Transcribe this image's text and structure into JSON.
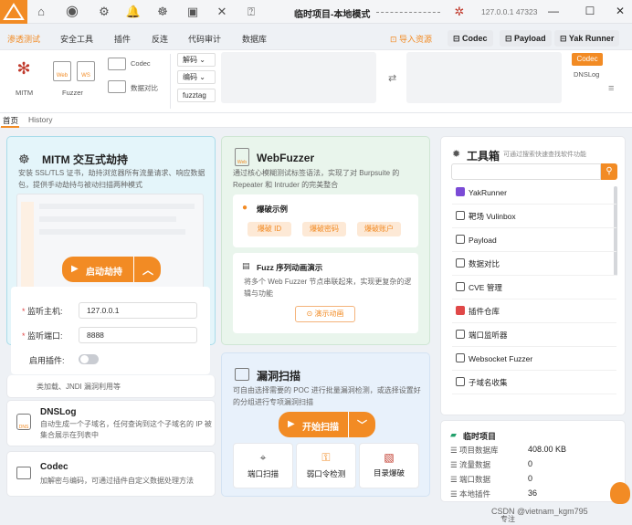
{
  "titlebar": {
    "title": "临时项目-本地模式",
    "ip": "127.0.0.1",
    "port": "47323"
  },
  "menu": {
    "items": [
      "渗透测试",
      "安全工具",
      "插件",
      "反连",
      "代码审计",
      "数据库"
    ],
    "import": "导入资源",
    "buttons": [
      "Codec",
      "Payload",
      "Yak Runner"
    ]
  },
  "toolbar": {
    "mitm": "MITM",
    "fuzzer": "Fuzzer",
    "web": "Web",
    "ws": "WS",
    "codec": "Codec",
    "compare": "数据对比",
    "decode": "解码",
    "encode": "编码",
    "fuzztag": "fuzztag",
    "codec_chip": "Codec",
    "dnslog": "DNSLog"
  },
  "tabs": {
    "home": "首页",
    "history": "History"
  },
  "mitm": {
    "title": "MITM 交互式劫持",
    "desc": "安装 SSL/TLS 证书，劫持浏览器所有流量请求、响应数据包，提供手动劫持与被动扫描两种模式",
    "start": "启动劫持",
    "host_label": "监听主机:",
    "host": "127.0.0.1",
    "port_label": "监听端口:",
    "port": "8888",
    "plugin_label": "启用插件:",
    "behind_text": "类加载、JNDI 漏洞利用等"
  },
  "webfuzzer": {
    "title": "WebFuzzer",
    "desc": "通过核心模糊测试标签语法，实现了对 Burpsuite 的 Repeater 和 Intruder 的完美整合",
    "blast_title": "爆破示例",
    "chips": [
      "爆破 ID",
      "爆破密码",
      "爆破账户"
    ],
    "seq_title": "Fuzz 序列动画演示",
    "seq_desc": "将多个 Web Fuzzer 节点串联起来，实现更复杂的逻辑与功能",
    "demo": "演示动画"
  },
  "scan": {
    "title": "漏洞扫描",
    "desc": "可自由选择需要的 POC 进行批量漏洞检测，或选择设置好的分组进行专项漏洞扫描",
    "start": "开始扫描",
    "tools": [
      "端口扫描",
      "弱口令检测",
      "目录爆破"
    ]
  },
  "dnslog": {
    "title": "DNSLog",
    "desc": "自动生成一个子域名，任何查询到这个子域名的 IP 被集合展示在列表中"
  },
  "codec": {
    "title": "Codec",
    "desc": "加解密与编码，可通过插件自定义数据处理方法"
  },
  "toolbox": {
    "title": "工具箱",
    "hint": "可通过搜索快速查找软件功能",
    "items": [
      "YakRunner",
      "靶场 Vulinbox",
      "Payload",
      "数据对比",
      "CVE 管理",
      "插件仓库",
      "端口监听器",
      "Websocket Fuzzer",
      "子域名收集"
    ]
  },
  "project": {
    "title": "临时项目",
    "stats": [
      {
        "label": "项目数据库",
        "value": "408.00 KB"
      },
      {
        "label": "流量数据",
        "value": "0"
      },
      {
        "label": "端口数据",
        "value": "0"
      },
      {
        "label": "本地插件",
        "value": "36"
      }
    ]
  },
  "status": {
    "watermark": "CSDN @vietnam_kgm795",
    "left": "专注"
  }
}
